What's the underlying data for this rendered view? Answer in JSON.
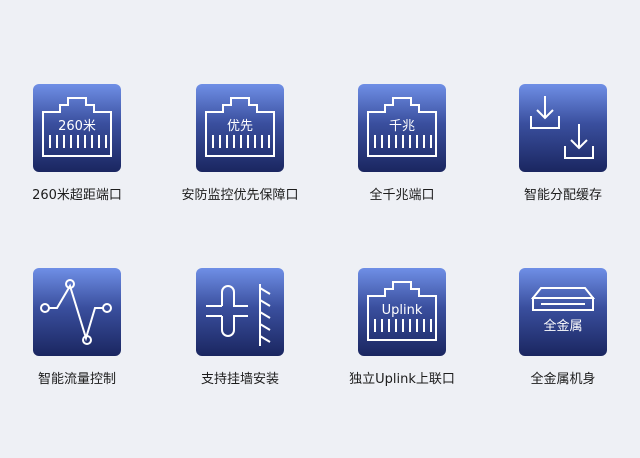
{
  "features": [
    {
      "label": "260米超距端口",
      "icon_text": "260米",
      "icon": "ethernet-port-icon"
    },
    {
      "label": "安防监控优先保障口",
      "icon_text": "优先",
      "icon": "ethernet-port-icon"
    },
    {
      "label": "全千兆端口",
      "icon_text": "千兆",
      "icon": "ethernet-port-icon"
    },
    {
      "label": "智能分配缓存",
      "icon": "download-arrows-icon"
    },
    {
      "label": "智能流量控制",
      "icon": "traffic-graph-icon"
    },
    {
      "label": "支持挂墙安装",
      "icon": "wall-mount-icon"
    },
    {
      "label": "独立Uplink上联口",
      "icon_text": "Uplink",
      "icon": "ethernet-port-icon"
    },
    {
      "label": "全金属机身",
      "icon_text": "全金属",
      "icon": "metal-chassis-icon"
    }
  ],
  "colors": {
    "background": "#eef0f5",
    "tile_top": "#6f8fe6",
    "tile_bottom": "#1a2660",
    "icon_stroke": "#ffffff",
    "text": "#1c1c1c"
  }
}
